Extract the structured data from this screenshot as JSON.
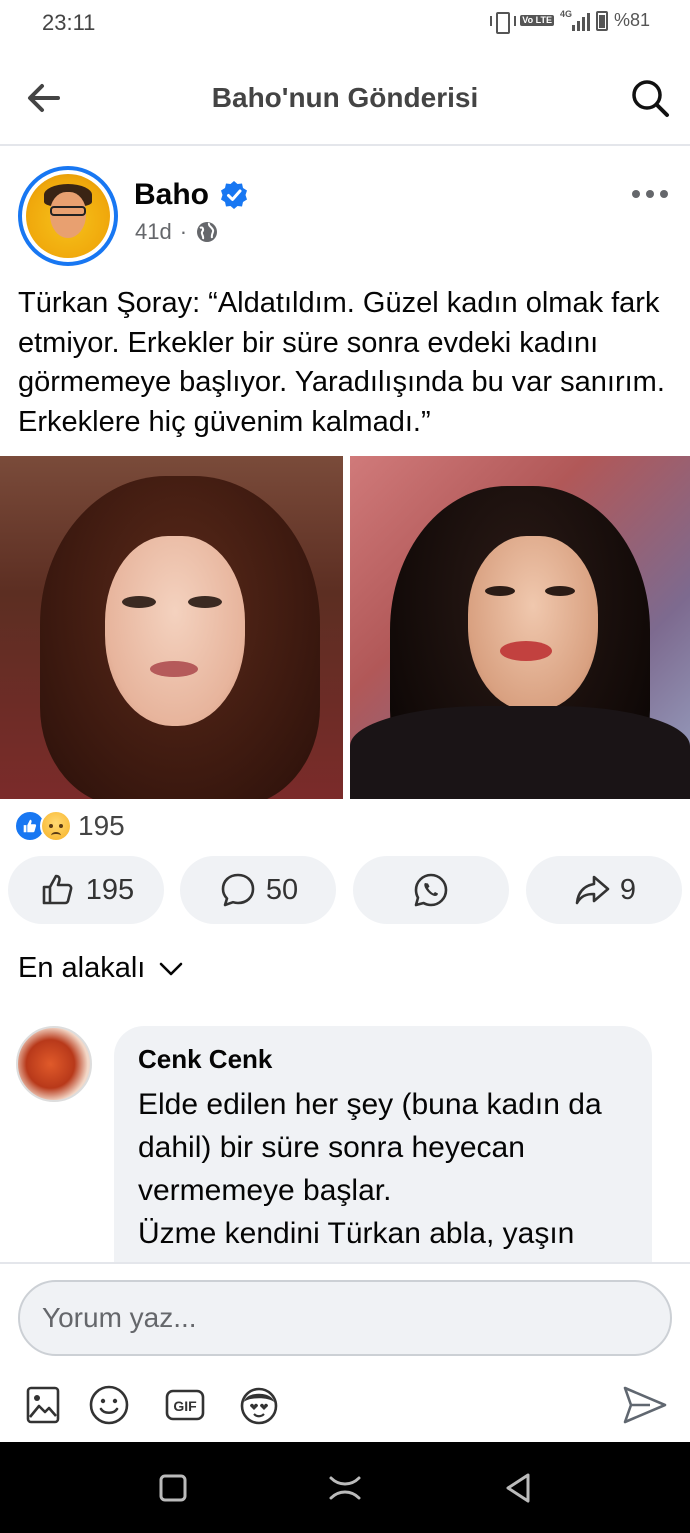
{
  "status_bar": {
    "time": "23:11",
    "network": "4G",
    "volte": "Vo LTE",
    "battery": "%81"
  },
  "header": {
    "title": "Baho'nun Gönderisi"
  },
  "post": {
    "author": "Baho",
    "verified": true,
    "time": "41d",
    "separator": "·",
    "text": "Türkan Şoray: “Aldatıldım. Güzel kadın olmak fark etmiyor. Erkekler bir süre sonra evdeki kadını görmemeye başlıyor. Yaradılışında bu var sanırım. Erkeklere hiç güvenim kalmadı.”",
    "reactions_count": "195",
    "actions": {
      "like_count": "195",
      "comment_count": "50",
      "share_count": "9"
    }
  },
  "comments": {
    "sort_label": "En alakalı",
    "items": [
      {
        "name": "Cenk Cenk",
        "text": "Elde edilen her şey (buna kadın da dahil) bir süre sonra heyecan vermemeye başlar.\nÜzme kendini Türkan abla, yaşın"
      }
    ]
  },
  "composer": {
    "placeholder": "Yorum yaz..."
  },
  "colors": {
    "accent": "#1877f2",
    "pill_bg": "#f0f2f5",
    "text": "#050505",
    "muted": "#65676b"
  },
  "icons": [
    "back-arrow-icon",
    "search-icon",
    "verified-icon",
    "globe-icon",
    "more-icon",
    "like-icon",
    "comment-icon",
    "whatsapp-icon",
    "share-icon",
    "chevron-down-icon",
    "photo-icon",
    "emoji-icon",
    "gif-icon",
    "avatar-sticker-icon",
    "send-icon"
  ]
}
